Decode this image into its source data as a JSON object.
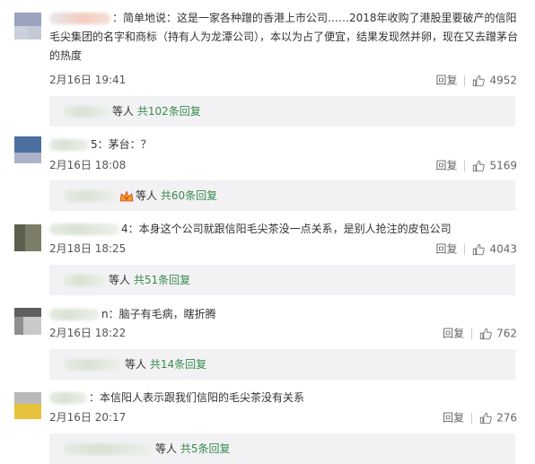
{
  "comments": [
    {
      "name_suffix": "：",
      "text": "简单地说：这是一家各种蹭的香港上市公司……2018年收购了港股里要破产的信阳毛尖集团的名字和商标（持有人为龙潭公司），本以为占了便宜，结果发现然并卵，现在又去蹭茅台的热度",
      "time": "2月16日 19:41",
      "reply_label": "回复",
      "likes": "4952",
      "replies": {
        "prefix": "等人",
        "link": "共102条回复"
      }
    },
    {
      "name_suffix": "5：",
      "text": "茅台：？",
      "time": "2月16日 18:08",
      "reply_label": "回复",
      "likes": "5169",
      "replies": {
        "prefix": "等人",
        "link": "共60条回复"
      }
    },
    {
      "name_suffix": "4：",
      "text": "本身这个公司就跟信阳毛尖茶没一点关系，是别人抢注的皮包公司",
      "time": "2月18日 18:25",
      "reply_label": "回复",
      "likes": "4043",
      "replies": {
        "prefix": "等人",
        "link": "共51条回复"
      }
    },
    {
      "name_suffix": "n：",
      "text": "脑子有毛病，瞎折腾",
      "time": "2月16日 18:22",
      "reply_label": "回复",
      "likes": "762",
      "replies": {
        "prefix": "等人",
        "link": "共14条回复"
      }
    },
    {
      "name_suffix": "：",
      "text": "本信阳人表示跟我们信阳的毛尖茶没有关系",
      "time": "2月16日 20:17",
      "reply_label": "回复",
      "likes": "276",
      "replies": {
        "prefix": "等人",
        "link": "共5条回复"
      }
    }
  ],
  "icons": {
    "like": "thumbs-up-icon",
    "vip": "crown-icon"
  },
  "colors": {
    "link": "#3a8b4b",
    "reply_bg": "#f2f2f5"
  }
}
